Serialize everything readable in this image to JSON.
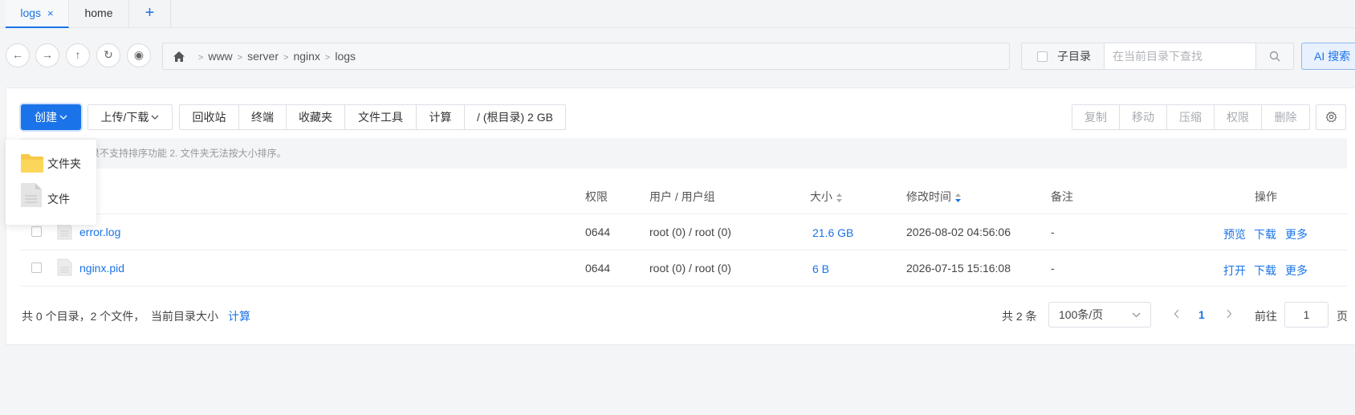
{
  "tabs": [
    {
      "label": "logs",
      "close": "×"
    },
    {
      "label": "home"
    },
    {
      "add": "+"
    }
  ],
  "nav": {
    "back": "←",
    "forward": "→",
    "up": "↑",
    "refresh": "↻",
    "view": "◉",
    "breadcrumb": [
      "www",
      "server",
      "nginx",
      "logs"
    ],
    "breadcrumb_sep": ">",
    "subdir_label": "子目录",
    "search_placeholder": "在当前目录下查找",
    "ai_search": "AI 搜索"
  },
  "toolbar": {
    "create": "创建",
    "upload_download": "上传/下载",
    "buttons": [
      "回收站",
      "终端",
      "收藏夹",
      "文件工具",
      "计算",
      "/ (根目录) 2 GB"
    ],
    "actions": [
      "复制",
      "移动",
      "压缩",
      "权限",
      "删除"
    ]
  },
  "dropdown": {
    "items": [
      "文件夹",
      "文件"
    ]
  },
  "notice": "结果不支持排序功能 2. 文件夹无法按大小排序。",
  "table": {
    "headers": {
      "perm": "权限",
      "owner": "用户 / 用户组",
      "size": "大小",
      "mtime": "修改时间",
      "note": "备注",
      "ops": "操作"
    },
    "rows": [
      {
        "name": "error.log",
        "perm": "0644",
        "owner": "root (0) / root (0)",
        "size": "21.6 GB",
        "mtime": "2026-08-02 04:56:06",
        "note": "-",
        "ops": [
          "预览",
          "下载",
          "更多"
        ]
      },
      {
        "name": "nginx.pid",
        "perm": "0644",
        "owner": "root (0) / root (0)",
        "size": "6 B",
        "mtime": "2026-07-15 15:16:08",
        "note": "-",
        "ops": [
          "打开",
          "下载",
          "更多"
        ]
      }
    ]
  },
  "footer": {
    "summary": "共 0 个目录，2 个文件，",
    "dir_size_label": "当前目录大小",
    "calc": "计算",
    "total": "共 2 条",
    "page_size": "100条/页",
    "current_page": "1",
    "goto_label": "前往",
    "goto_value": "1",
    "page_unit": "页"
  },
  "colors": {
    "accent": "#1a73e8",
    "folder": "#f7c948"
  }
}
